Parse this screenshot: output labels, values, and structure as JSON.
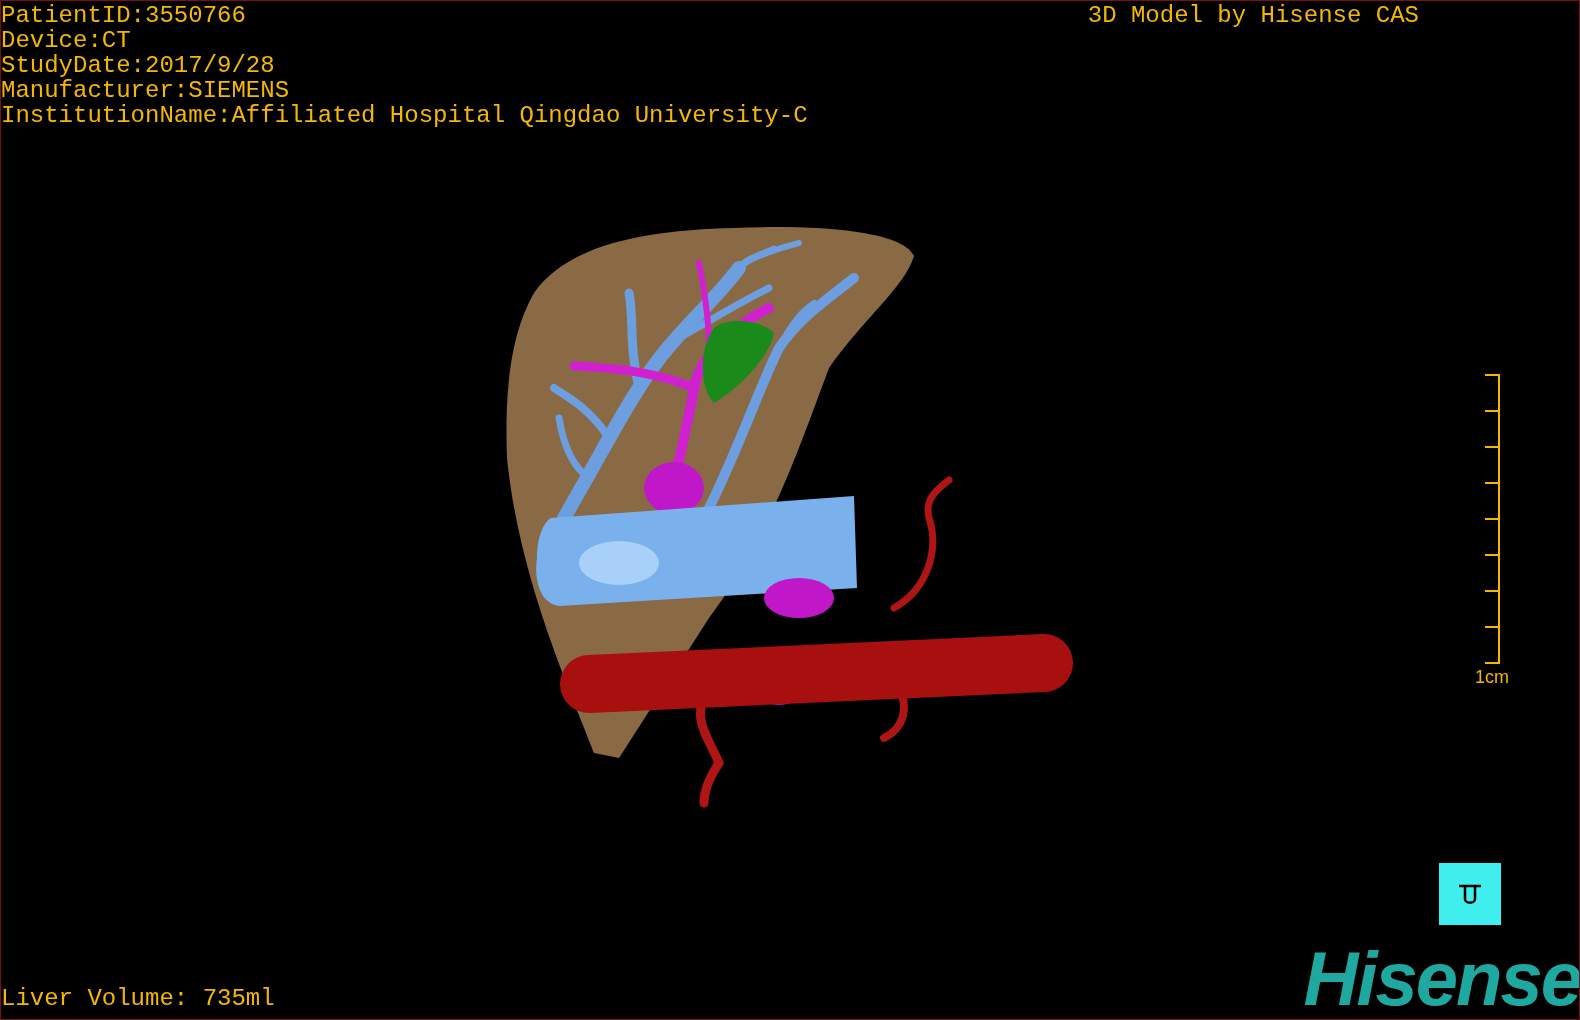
{
  "header": {
    "info_lines": [
      "PatientID:3550766",
      "Device:CT",
      "StudyDate:2017/9/28",
      "Manufacturer:SIEMENS",
      "InstitutionName:Affiliated Hospital Qingdao University-C"
    ],
    "title": "3D Model by Hisense CAS"
  },
  "scale_bar": {
    "label": "1cm"
  },
  "footer": {
    "liver_volume": "Liver Volume: 735ml",
    "logo": "Hisense"
  }
}
